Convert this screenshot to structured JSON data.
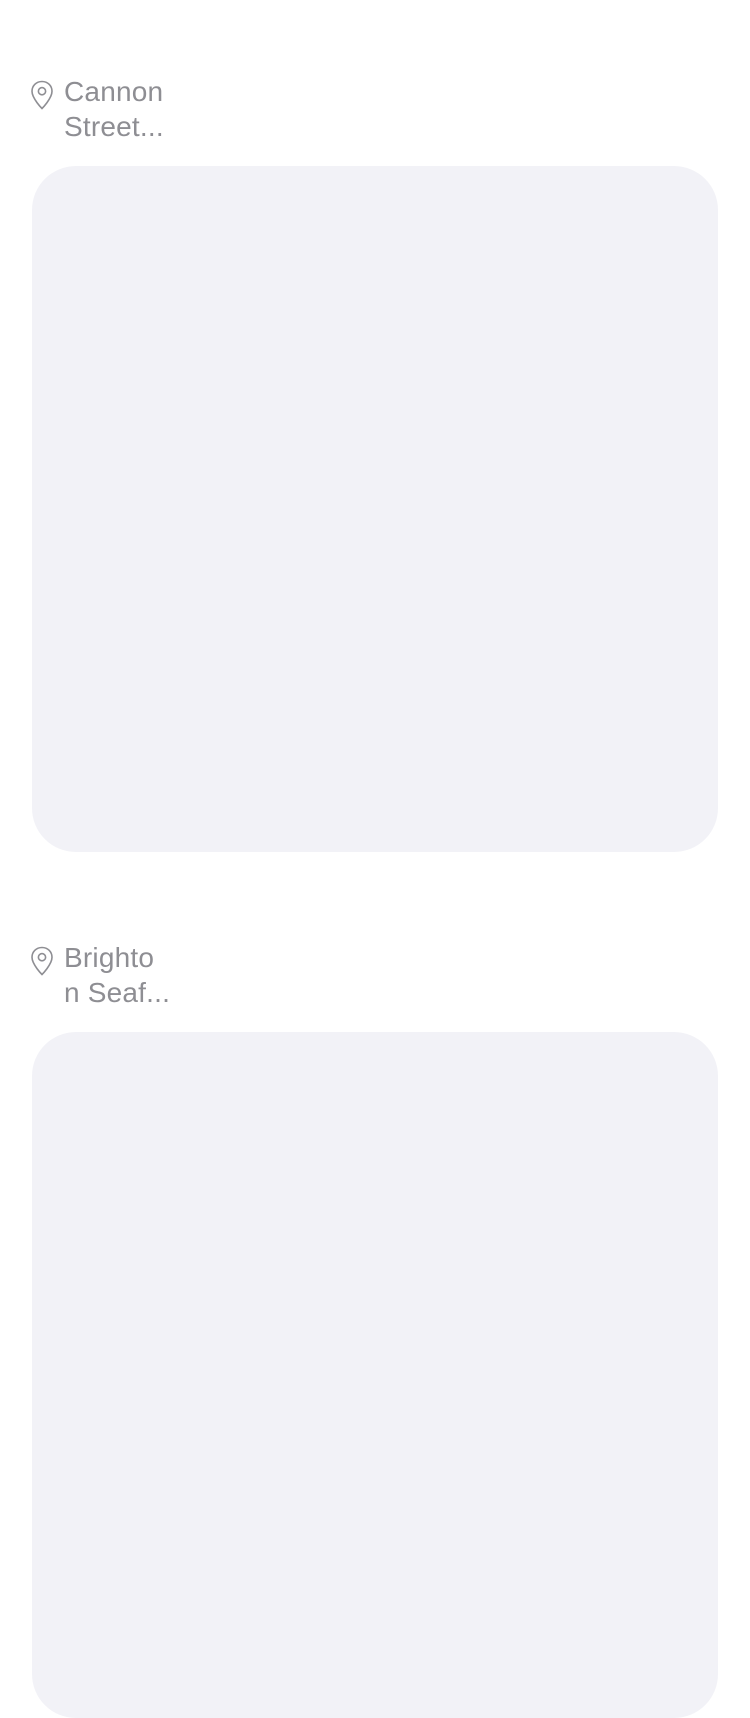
{
  "posts": [
    {
      "location_line1": "Cannon",
      "location_line2": "Street..."
    },
    {
      "location_line1": "Brighto",
      "location_line2": "n Seaf..."
    }
  ],
  "colors": {
    "background": "#ffffff",
    "placeholder": "#f2f2f7",
    "secondary_text": "#8e8e93"
  },
  "icons": {
    "location": "map-pin-icon"
  }
}
